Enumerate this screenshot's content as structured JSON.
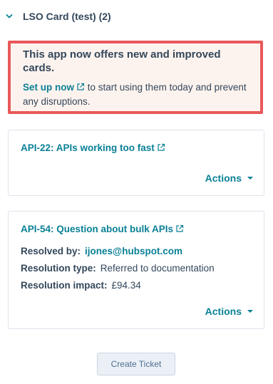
{
  "section": {
    "title": "LSO Card (test) (2)"
  },
  "alert": {
    "title": "This app now offers new and improved cards.",
    "link_label": "Set up now",
    "body_rest": "to start using them today and prevent any disruptions.",
    "border_color": "#e8585a",
    "background_color": "#fdf3ee"
  },
  "tickets": [
    {
      "title": "API-22: APIs working too fast",
      "actions_label": "Actions"
    },
    {
      "title": "API-54: Question about bulk APIs",
      "fields": [
        {
          "label": "Resolved by:",
          "value": "ijones@hubspot.com",
          "is_link": true
        },
        {
          "label": "Resolution type:",
          "value": "Referred to documentation"
        },
        {
          "label": "Resolution impact:",
          "value": "£94.34"
        }
      ],
      "actions_label": "Actions"
    }
  ],
  "create_button": {
    "label": "Create Ticket"
  },
  "colors": {
    "link": "#0a8096",
    "text": "#33475b"
  },
  "icons": [
    "chevron-down-icon",
    "external-link-icon",
    "caret-down-icon"
  ]
}
